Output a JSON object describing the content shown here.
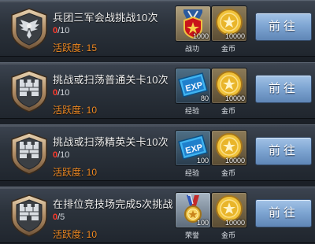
{
  "tasks": [
    {
      "title": "兵团三军会战挑战10次",
      "progress_current": "0",
      "progress_total": "/10",
      "activity": "活跃度: 15",
      "badge": "wings-badge",
      "rewards": [
        {
          "icon": "medal-star-icon",
          "qty": "1000",
          "label": "战功"
        },
        {
          "icon": "gold-coin-icon",
          "qty": "10000",
          "label": "金币"
        }
      ],
      "button": "前往"
    },
    {
      "title": "挑战或扫荡普通关卡10次",
      "progress_current": "0",
      "progress_total": "/10",
      "activity": "活跃度: 10",
      "badge": "wall-badge",
      "rewards": [
        {
          "icon": "exp-icon",
          "qty": "80",
          "label": "经验"
        },
        {
          "icon": "gold-coin-icon",
          "qty": "10000",
          "label": "金币"
        }
      ],
      "button": "前往"
    },
    {
      "title": "挑战或扫荡精英关卡10次",
      "progress_current": "0",
      "progress_total": "/10",
      "activity": "活跃度: 10",
      "badge": "wall-badge",
      "rewards": [
        {
          "icon": "exp-icon",
          "qty": "100",
          "label": "经验"
        },
        {
          "icon": "gold-coin-icon",
          "qty": "10000",
          "label": "金币"
        }
      ],
      "button": "前往"
    },
    {
      "title": "在排位竞技场完成5次挑战",
      "progress_current": "0",
      "progress_total": "/5",
      "activity": "活跃度: 10",
      "badge": "wall-badge",
      "rewards": [
        {
          "icon": "honor-medal-icon",
          "qty": "100",
          "label": "荣誉"
        },
        {
          "icon": "gold-coin-icon",
          "qty": "10000",
          "label": "金币"
        }
      ],
      "button": "前往"
    }
  ],
  "colors": {
    "activity": "#f08a23",
    "progress_current": "#ff3a2c",
    "button": "#7fa6d3"
  }
}
